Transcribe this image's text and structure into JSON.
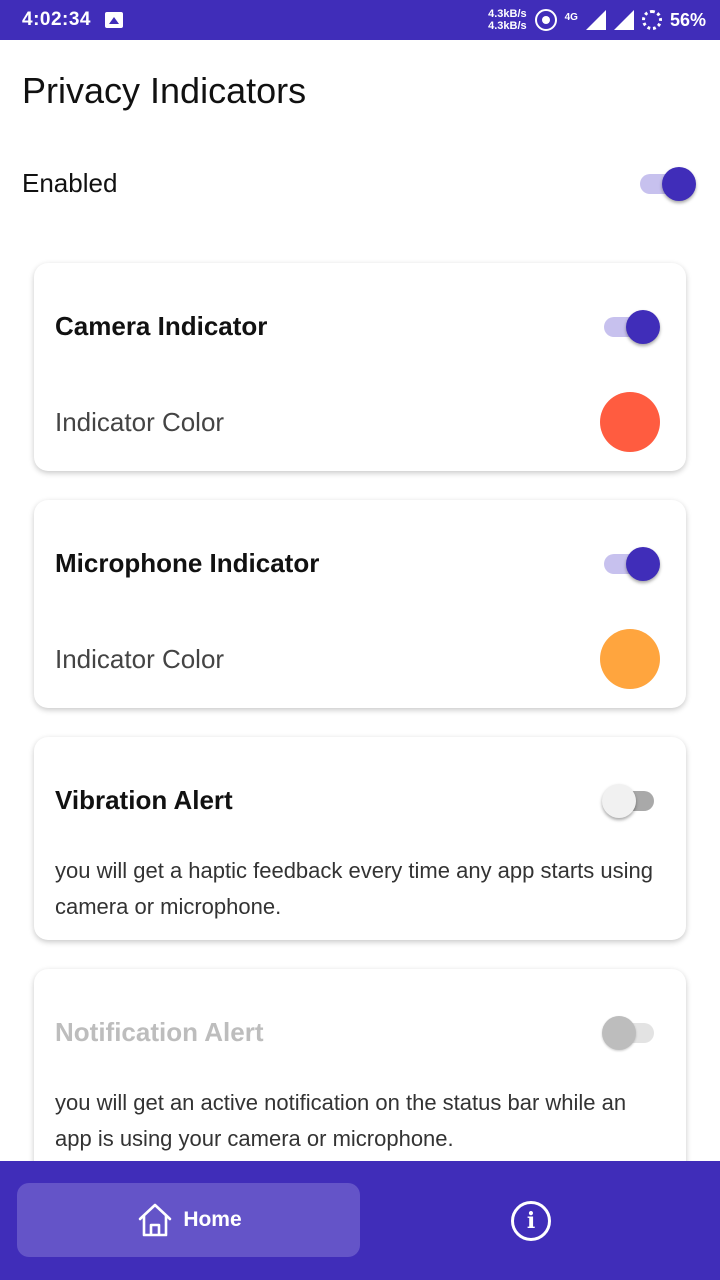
{
  "status_bar": {
    "time": "4:02:34",
    "upload_speed": "4.3kB/s",
    "download_speed": "4.3kB/s",
    "network_type": "4G",
    "battery": "56%"
  },
  "header": {
    "title": "Privacy Indicators"
  },
  "master": {
    "label": "Enabled",
    "enabled": true
  },
  "cards": {
    "camera": {
      "title": "Camera Indicator",
      "enabled": true,
      "color_label": "Indicator Color",
      "color": "#ff5c40"
    },
    "microphone": {
      "title": "Microphone Indicator",
      "enabled": true,
      "color_label": "Indicator Color",
      "color": "#ffa53e"
    },
    "vibration": {
      "title": "Vibration Alert",
      "enabled": false,
      "description": "you will get a haptic feedback every time any app starts using camera or microphone."
    },
    "notification": {
      "title": "Notification Alert",
      "enabled": false,
      "disabled": true,
      "description": "you will get an active notification on the status bar while an app is using your camera or microphone."
    }
  },
  "bottom_nav": {
    "home_label": "Home",
    "accent": "#402db9"
  },
  "icons": [
    "gallery-icon",
    "hotspot-icon",
    "signal-icon",
    "battery-icon",
    "home-icon",
    "info-icon"
  ]
}
